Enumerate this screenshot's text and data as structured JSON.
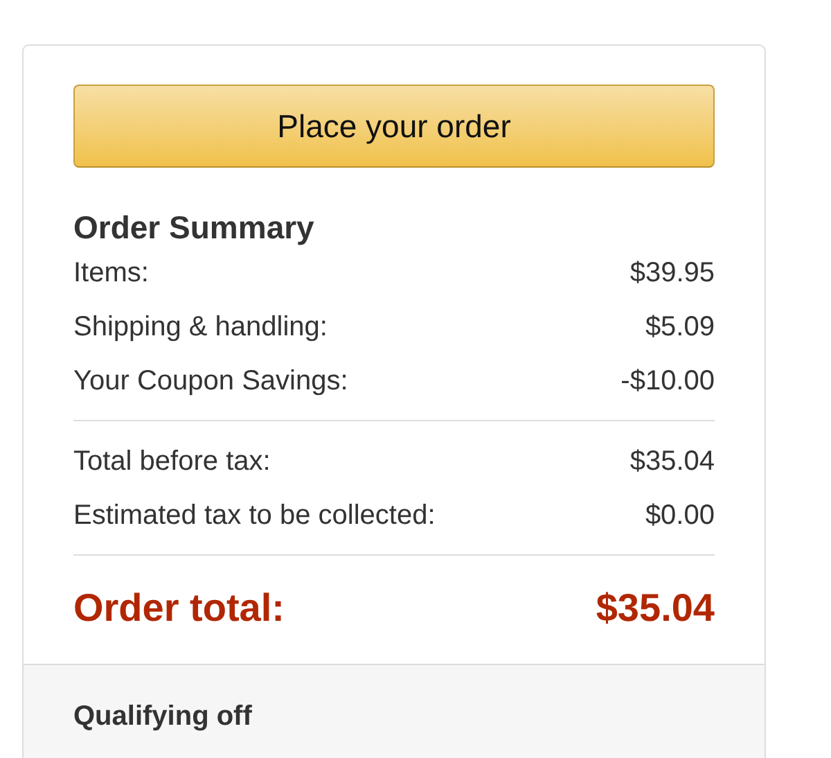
{
  "order_button": {
    "label": "Place your order"
  },
  "summary": {
    "title": "Order Summary",
    "groups": [
      {
        "rows": [
          {
            "label": "Items:",
            "value": "$39.95"
          },
          {
            "label": "Shipping & handling:",
            "value": "$5.09"
          },
          {
            "label": "Your Coupon Savings:",
            "value": "-$10.00"
          }
        ]
      },
      {
        "rows": [
          {
            "label": "Total before tax:",
            "value": "$35.04"
          },
          {
            "label": "Estimated tax to be collected:",
            "value": "$0.00"
          }
        ]
      }
    ],
    "total": {
      "label": "Order total:",
      "value": "$35.04"
    }
  },
  "footer": {
    "heading": "Qualifying off"
  }
}
